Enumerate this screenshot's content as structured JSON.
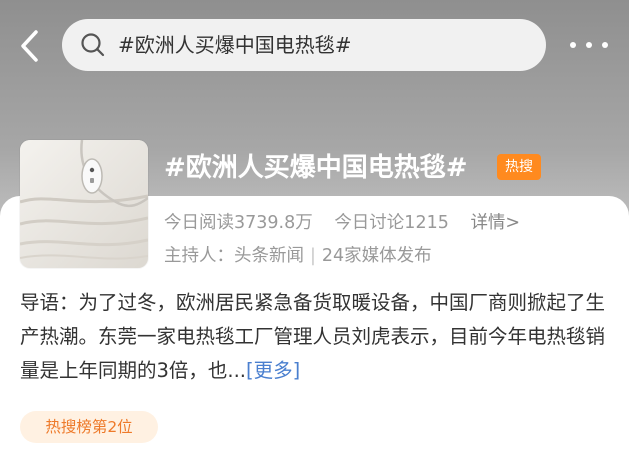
{
  "colors": {
    "page_bg_top": "#8f8f8f",
    "search_bg": "#f1f1f1",
    "hot_badge": "#ff8a1f",
    "link": "#4a7fcf",
    "rank_badge_bg": "#fff1e2",
    "rank_badge_text": "#ee7a2a"
  },
  "header": {
    "back_icon": "chevron-left-icon",
    "search_icon": "search-icon",
    "search_query": "#欧洲人买爆中国电热毯#",
    "more_icon": "more-dots-icon"
  },
  "topic": {
    "thumbnail": "electric-blanket-photo",
    "title": "#欧洲人买爆中国电热毯#",
    "hot_badge": "热搜",
    "reads": "今日阅读3739.8万",
    "discussions": "今日讨论1215",
    "detail_link": "详情>",
    "host_label": "主持人：头条新闻",
    "media": "24家媒体发布"
  },
  "intro": {
    "text": "导语：为了过冬，欧洲居民紧急备货取暖设备，中国厂商则掀起了生产热潮。东莞一家电热毯工厂管理人员刘虎表示，目前今年电热毯销量是上年同期的3倍，也...",
    "more_link": "[更多]"
  },
  "rank_badge": "热搜榜第2位"
}
